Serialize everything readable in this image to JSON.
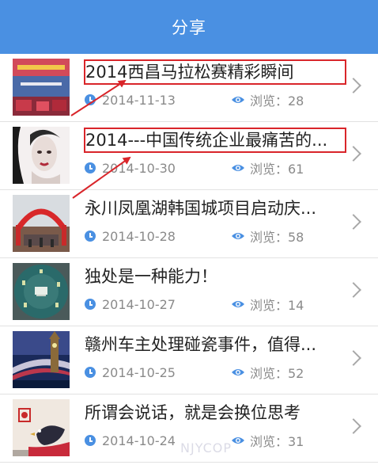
{
  "header": {
    "title": "分享"
  },
  "watermark": "NJYCOP",
  "colors": {
    "header_bg": "#4a90e2",
    "annotation_red": "#d9252a"
  },
  "items": [
    {
      "title": "2014西昌马拉松赛精彩瞬间",
      "date": "2014-11-13",
      "views_label": "浏览：28",
      "highlighted": true
    },
    {
      "title": "2014---中国传统企业最痛苦的...",
      "date": "2014-10-30",
      "views_label": "浏览：61",
      "highlighted": true
    },
    {
      "title": "永川凤凰湖韩国城项目启动庆...",
      "date": "2014-10-28",
      "views_label": "浏览：58",
      "highlighted": false
    },
    {
      "title": "独处是一种能力！",
      "date": "2014-10-27",
      "views_label": "浏览：14",
      "highlighted": false
    },
    {
      "title": "赣州车主处理碰瓷事件，值得...",
      "date": "2014-10-25",
      "views_label": "浏览：52",
      "highlighted": false
    },
    {
      "title": "所谓会说话，就是会换位思考",
      "date": "2014-10-24",
      "views_label": "浏览：31",
      "highlighted": false
    }
  ]
}
